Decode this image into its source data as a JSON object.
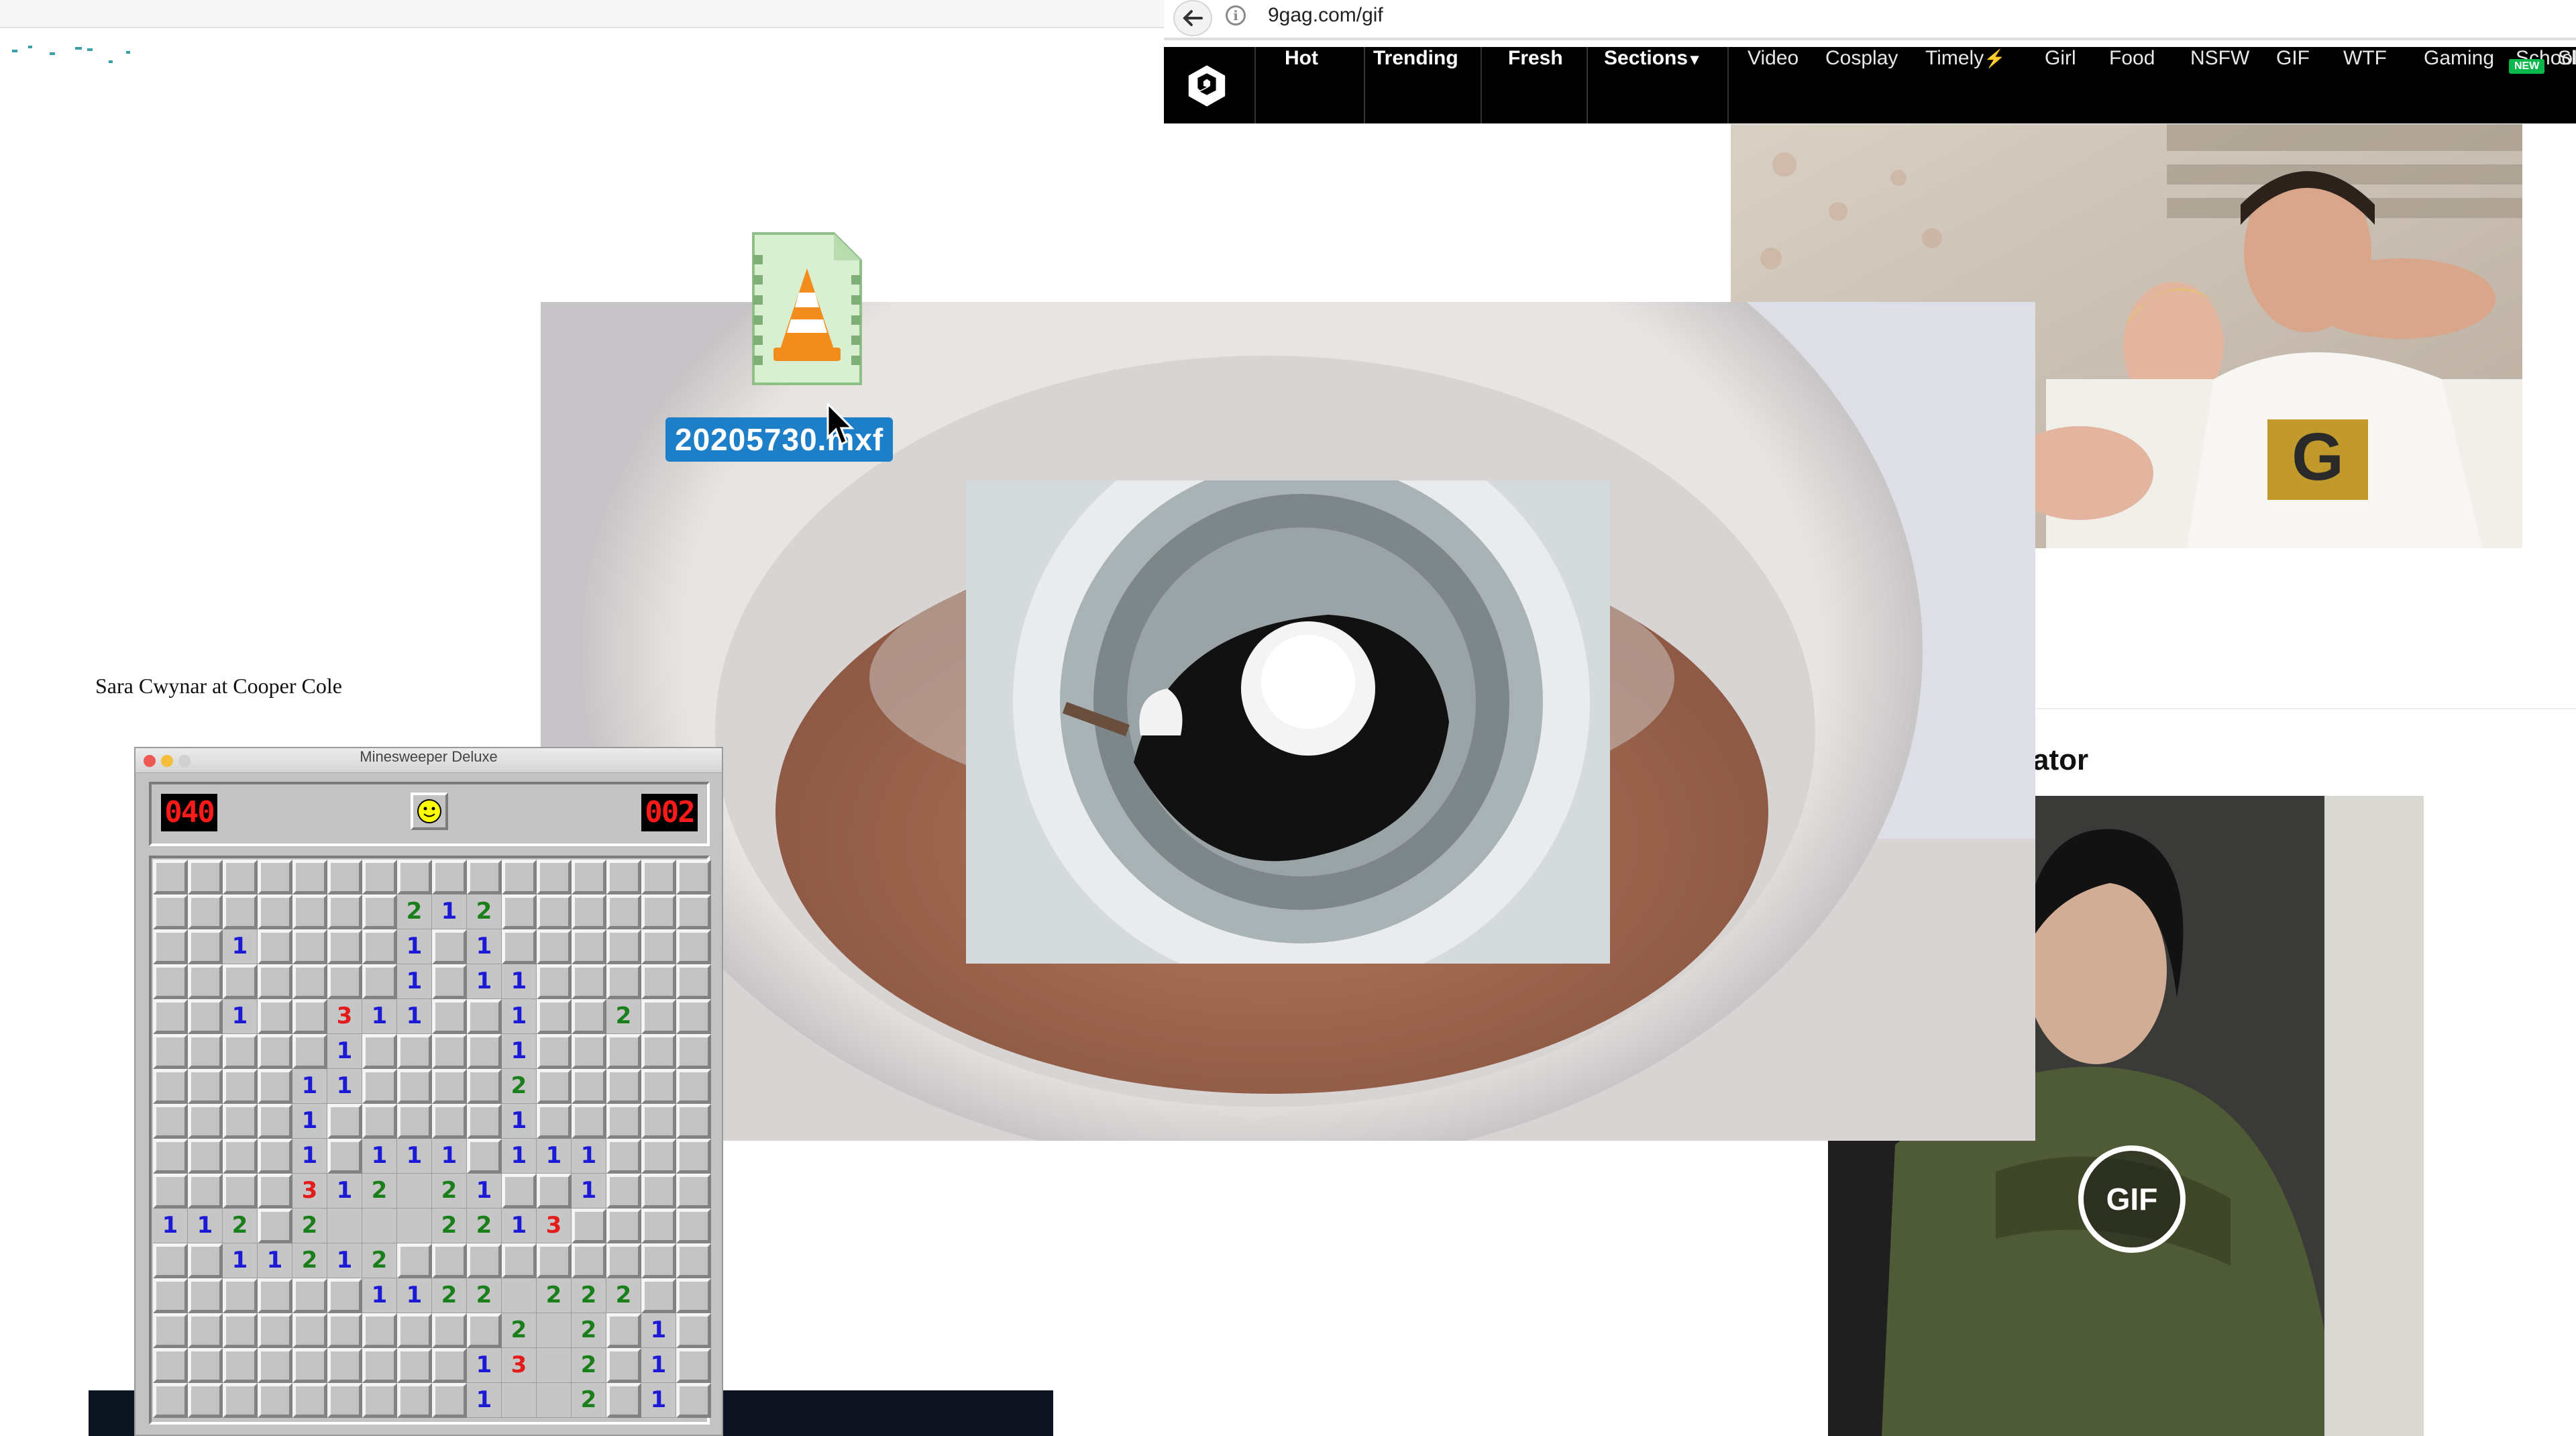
{
  "browser": {
    "url": "9gag.com/gif"
  },
  "nav": {
    "items": [
      {
        "label": "Hot",
        "bold": true
      },
      {
        "label": "Trending",
        "bold": true
      },
      {
        "label": "Fresh",
        "bold": true
      },
      {
        "label": "Sections",
        "bold": true
      },
      {
        "label": "Video",
        "bold": false
      },
      {
        "label": "Cosplay",
        "bold": false
      },
      {
        "label": "Timely",
        "bold": false
      },
      {
        "label": "Girl",
        "bold": false
      },
      {
        "label": "Food",
        "bold": false
      },
      {
        "label": "NSFW",
        "bold": false
      },
      {
        "label": "GIF",
        "bold": false
      },
      {
        "label": "WTF",
        "bold": false
      },
      {
        "label": "Gaming",
        "bold": false
      },
      {
        "label": "School",
        "bold": false
      },
      {
        "label": "Sl",
        "bold": false
      }
    ],
    "new_badge": "NEW",
    "lightning_glyph": "⚡",
    "caret_glyph": "▾"
  },
  "post": {
    "heading_partial": "ator",
    "gif_badge": "GIF"
  },
  "desktop": {
    "file_name": "20205730.mxf",
    "file_icon": "vlc-cone-icon",
    "caption": "Sara Cwynar at Cooper Cole"
  },
  "minesweeper": {
    "title": "Minesweeper Deluxe",
    "mines_remaining": "040",
    "timer": "002",
    "face": "smiley-icon",
    "grid": [
      "################",
      "#######212######",
      "##1####1#1######",
      "#######1#11#####",
      "##1##311##1##2##",
      "#####1####1#####",
      "####11####2#####",
      "####1#####1#####",
      "####1#111#111###",
      "####312.21##1###",
      "112#2...2213####",
      "##11212#########",
      "######1122.222##",
      "##########2.2#1#",
      "#########13.2#1#",
      "#########1..2#1#"
    ],
    "number_colors": {
      "1": "#1b1bd6",
      "2": "#1a7f1a",
      "3": "#e41b1b"
    }
  },
  "colors": {
    "nav_bg": "#000000",
    "file_label_bg": "#1e7fc9",
    "new_badge": "#09b84a"
  }
}
